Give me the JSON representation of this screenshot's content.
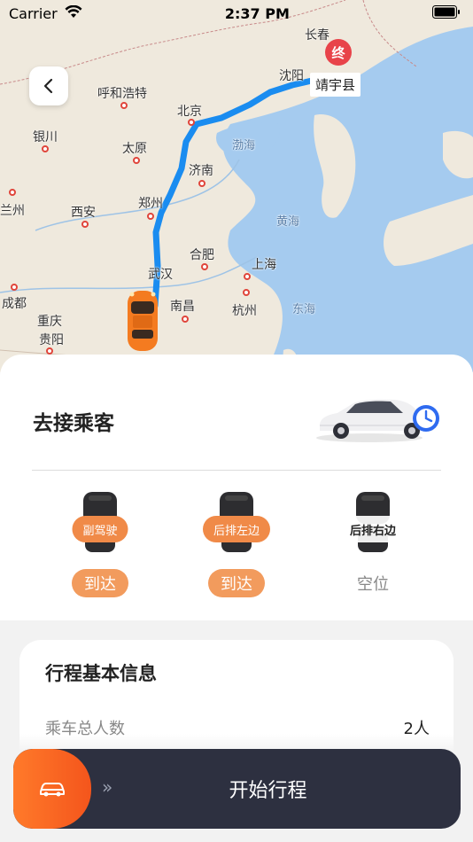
{
  "status_bar": {
    "carrier": "Carrier",
    "time": "2:37 PM"
  },
  "map": {
    "cities": [
      {
        "label": "长春"
      },
      {
        "label": "沈阳"
      },
      {
        "label": "靖宇县"
      },
      {
        "label": "呼和浩特"
      },
      {
        "label": "北京"
      },
      {
        "label": "银川"
      },
      {
        "label": "太原"
      },
      {
        "label": "渤海"
      },
      {
        "label": "济南"
      },
      {
        "label": "兰州"
      },
      {
        "label": "西安"
      },
      {
        "label": "郑州"
      },
      {
        "label": "黄海"
      },
      {
        "label": "合肥"
      },
      {
        "label": "武汉"
      },
      {
        "label": "上海"
      },
      {
        "label": "成都"
      },
      {
        "label": "南昌"
      },
      {
        "label": "杭州"
      },
      {
        "label": "东海"
      },
      {
        "label": "重庆"
      },
      {
        "label": "贵阳"
      }
    ],
    "end_marker": "终",
    "end_label": "靖宇县",
    "route_color": "#1a8cf0",
    "water_color": "#a5cbef"
  },
  "sheet": {
    "title": "去接乘客",
    "seats": [
      {
        "name": "副驾驶",
        "status": "到达"
      },
      {
        "name": "后排左边",
        "status": "到达"
      },
      {
        "name": "后排右边",
        "status": "空位"
      }
    ]
  },
  "info": {
    "title": "行程基本信息",
    "rows": [
      {
        "key": "乘车总人数",
        "value": "2人"
      }
    ]
  },
  "start": {
    "label": "开始行程",
    "arrows": "»",
    "accent": "#f4551c",
    "bar_color": "#2d3040"
  }
}
